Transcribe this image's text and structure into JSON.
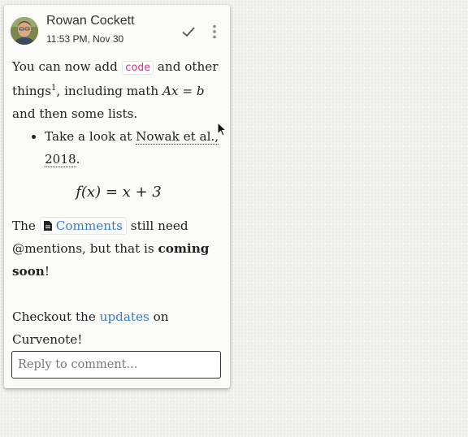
{
  "comment": {
    "author": "Rowan Cockett",
    "timestamp": "11:53 PM, Nov 30",
    "avatar_icon": "user-photo",
    "resolve_icon": "check-icon",
    "menu_icon": "more-vert-icon",
    "body": {
      "p1_text1": "You can now add",
      "code": "code",
      "p1_text2": "and other things",
      "footnote": "1",
      "p1_text3": ", including math",
      "math_inline": "Ax = b",
      "p1_text4": "and then some lists.",
      "list_text1": "Take a look at",
      "citation": "Nowak et al., 2018",
      "list_text2": ".",
      "equation": "f(x) = x + 3",
      "p2_text1": "The",
      "doc_link": "Comments",
      "p2_text2": "still need @mentions, but that is",
      "p2_bold": "coming soon",
      "p2_text3": "!",
      "p3_text1": "Checkout the",
      "p3_link": "updates",
      "p3_text2": "on Curvenote!"
    },
    "reply_placeholder": "Reply to comment..."
  },
  "colors": {
    "link": "#3b7bc8",
    "code": "#d63384"
  }
}
